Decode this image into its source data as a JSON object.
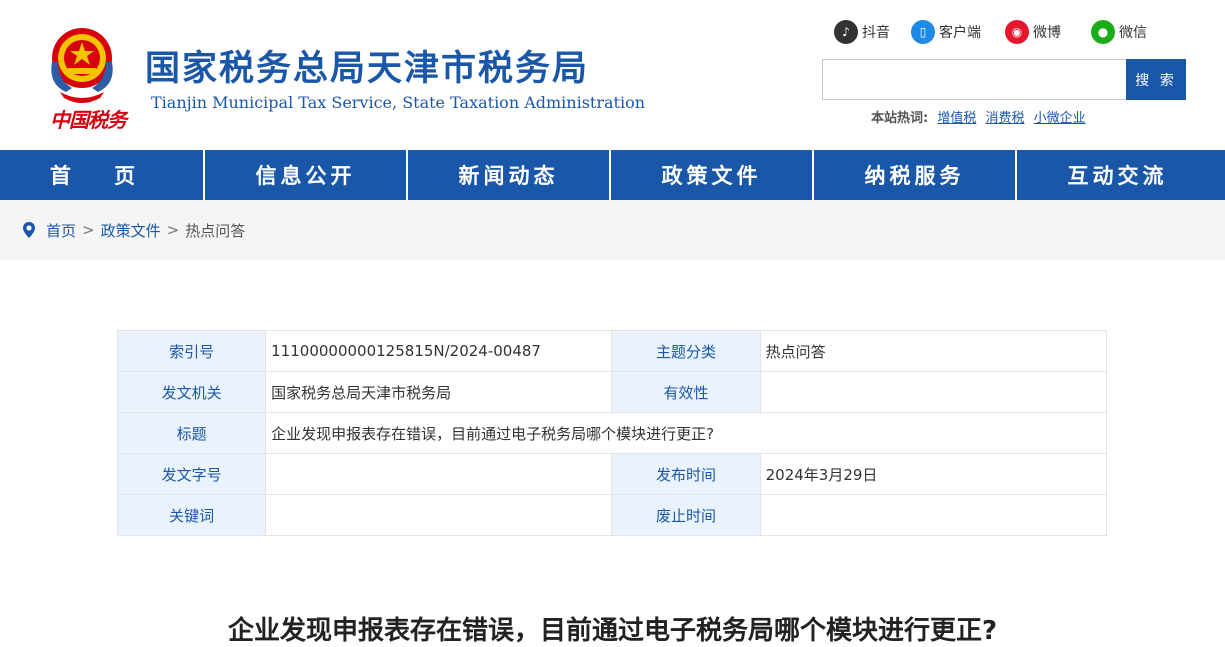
{
  "header": {
    "title_cn": "国家税务总局天津市税务局",
    "title_en": "Tianjin Municipal Tax Service, State Taxation Administration",
    "seal_text": "中国税务",
    "social": [
      {
        "label": "抖音",
        "icon": "douyin-icon",
        "color": "#333333"
      },
      {
        "label": "客户端",
        "icon": "mobile-client-icon",
        "color": "#1e88e5"
      },
      {
        "label": "微博",
        "icon": "weibo-icon",
        "color": "#e6162d"
      },
      {
        "label": "微信",
        "icon": "wechat-icon",
        "color": "#1aad19"
      }
    ],
    "search": {
      "placeholder": "",
      "button_label": "搜 索"
    },
    "hot": {
      "label": "本站热词:",
      "links": [
        "增值税",
        "消费税",
        "小微企业"
      ]
    }
  },
  "nav": [
    "首 页",
    "信息公开",
    "新闻动态",
    "政策文件",
    "纳税服务",
    "互动交流"
  ],
  "breadcrumb": {
    "home": "首页",
    "section": "政策文件",
    "current": "热点问答",
    "separator": ">"
  },
  "info": {
    "index_no_label": "索引号",
    "index_no": "11100000000125815N/2024-00487",
    "topic_label": "主题分类",
    "topic": "热点问答",
    "issuer_label": "发文机关",
    "issuer": "国家税务总局天津市税务局",
    "validity_label": "有效性",
    "validity": "",
    "title_label": "标题",
    "title": "企业发现申报表存在错误，目前通过电子税务局哪个模块进行更正?",
    "doc_no_label": "发文字号",
    "doc_no": "",
    "publish_label": "发布时间",
    "publish": "2024年3月29日",
    "keywords_label": "关键词",
    "keywords": "",
    "repeal_label": "废止时间",
    "repeal": ""
  },
  "article": {
    "title": "企业发现申报表存在错误，目前通过电子税务局哪个模块进行更正?"
  },
  "colors": {
    "brand_blue": "#1a57a8",
    "label_bg": "#eaf3fd",
    "seal_red": "#d7000f"
  }
}
